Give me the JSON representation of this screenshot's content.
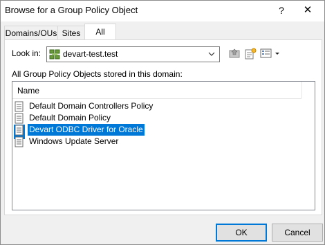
{
  "window": {
    "title": "Browse for a Group Policy Object",
    "help": "?",
    "close": "✕"
  },
  "tabs": [
    {
      "label": "Domains/OUs"
    },
    {
      "label": "Sites"
    },
    {
      "label": "All"
    }
  ],
  "lookin": {
    "label": "Look in:",
    "value": "devart-test.test"
  },
  "list": {
    "caption": "All Group Policy Objects stored in this domain:",
    "column": "Name",
    "items": [
      "Default Domain Controllers Policy",
      "Default Domain Policy",
      "Devart ODBC Driver for Oracle",
      "Windows Update Server"
    ],
    "selected_index": 2
  },
  "buttons": {
    "ok": "OK",
    "cancel": "Cancel"
  },
  "colors": {
    "selection": "#0078d7",
    "dialog_bg": "#f0f0f0"
  }
}
